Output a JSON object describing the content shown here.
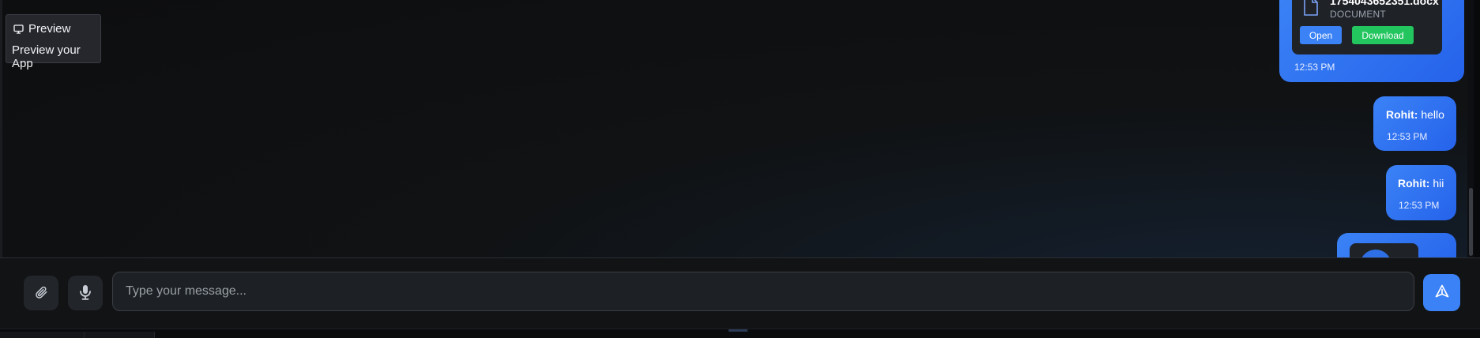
{
  "preview_tooltip": {
    "title": "Preview",
    "subtitle": "Preview your App",
    "icon": "monitor-icon"
  },
  "messages": [
    {
      "type": "document",
      "file_name": "1754043652351.docx",
      "file_type": "DOCUMENT",
      "open_label": "Open",
      "download_label": "Download",
      "time": "12:53 PM"
    },
    {
      "type": "text",
      "sender": "Rohit:",
      "text": "hello",
      "time": "12:53 PM"
    },
    {
      "type": "text",
      "sender": "Rohit:",
      "text": "hii",
      "time": "12:53 PM"
    },
    {
      "type": "attachment-partial"
    }
  ],
  "composer": {
    "placeholder": "Type your message...",
    "value": "",
    "attach_icon": "paperclip-icon",
    "mic_icon": "microphone-icon",
    "send_icon": "send-icon"
  },
  "colors": {
    "bubble": "#2563eb",
    "open_button": "#3b82f6",
    "download_button": "#22c55e",
    "send_button": "#3b82f6"
  }
}
